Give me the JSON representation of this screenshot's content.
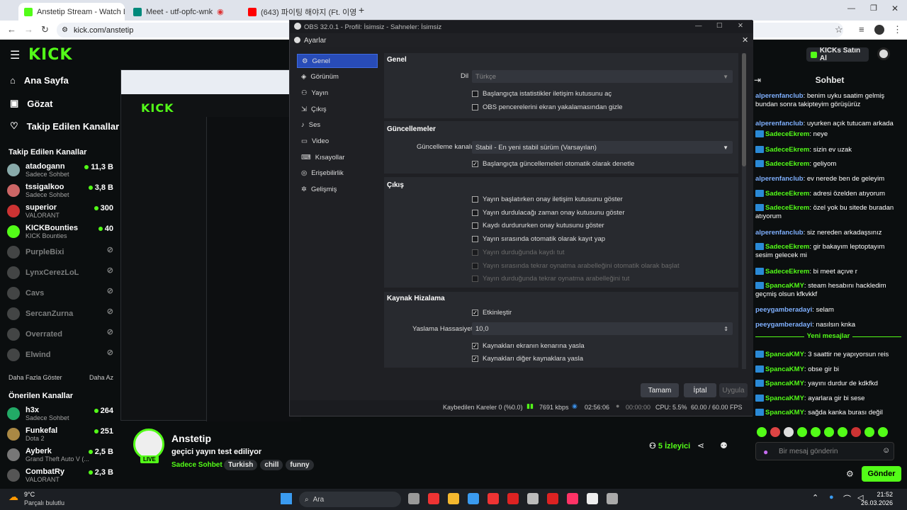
{
  "browser": {
    "tabs": [
      {
        "label": "Anstetip Stream - Watch Live o",
        "active": true,
        "color": "#53fc18"
      },
      {
        "label": "Meet - utf-opfc-wnk",
        "active": false,
        "color": "#00897b"
      },
      {
        "label": "(643) 파이팅 해야지 (Ft. 이영지",
        "active": false,
        "color": "#ff0000"
      }
    ],
    "url": "kick.com/anstetip"
  },
  "kick": {
    "logo": "KICK",
    "nav": [
      "Ana Sayfa",
      "Gözat",
      "Takip Edilen Kanallar"
    ],
    "followed_title": "Takip Edilen Kanallar",
    "followed": [
      {
        "name": "atadogann",
        "sub": "Sadece Sohbet",
        "count": "11,3 B",
        "color": "#8aa"
      },
      {
        "name": "tssigalkoo",
        "sub": "Sadece Sohbet",
        "count": "3,8 B",
        "color": "#c66"
      },
      {
        "name": "superior",
        "sub": "VALORANT",
        "count": "300",
        "color": "#c33"
      },
      {
        "name": "KICKBounties",
        "sub": "KICK Bounties",
        "count": "40",
        "color": "#53fc18"
      },
      {
        "name": "PurpleBixi",
        "sub": "",
        "count": "",
        "color": "#888"
      },
      {
        "name": "LynxCerezLoL",
        "sub": "",
        "count": "",
        "color": "#888"
      },
      {
        "name": "Cavs",
        "sub": "",
        "count": "",
        "color": "#888"
      },
      {
        "name": "SercanZurna",
        "sub": "",
        "count": "",
        "color": "#888"
      },
      {
        "name": "Overrated",
        "sub": "",
        "count": "",
        "color": "#888"
      },
      {
        "name": "Elwind",
        "sub": "",
        "count": "",
        "color": "#888"
      }
    ],
    "more": "Daha Fazla Göster",
    "less": "Daha Az",
    "rec_title": "Önerilen Kanallar",
    "recommended": [
      {
        "name": "h3x",
        "sub": "Sadece Sohbet",
        "count": "264",
        "color": "#2a6"
      },
      {
        "name": "Funkefal",
        "sub": "Dota 2",
        "count": "251",
        "color": "#a84"
      },
      {
        "name": "Ayberk",
        "sub": "Grand Theft Auto V (...",
        "count": "2,5 B",
        "color": "#777"
      },
      {
        "name": "CombatRy",
        "sub": "VALORANT",
        "count": "2,3 B",
        "color": "#555"
      }
    ],
    "streamer": "Anstetip",
    "stream_title": "geçici yayın test ediliyor",
    "category": "Sadece Sohbet",
    "tags": [
      "Turkish",
      "chill",
      "funny"
    ],
    "live": "LIVE",
    "viewers": "5 İzleyici",
    "buy": "KICKs Satın Al"
  },
  "chat": {
    "title": "Sohbet",
    "messages": [
      {
        "user": "alperenfanclub",
        "text": "benim uyku saatim gelmiş bundan sonra takipteyim görüşürüz",
        "color": "#7fb0ff",
        "badge": false
      },
      {
        "user": "alperenfanclub",
        "text": "uyurken açık tutucam arkada",
        "color": "#7fb0ff",
        "badge": false
      },
      {
        "user": "SadeceEkrem",
        "text": "neye",
        "color": "#53fc18",
        "badge": true
      },
      {
        "user": "SadeceEkrem",
        "text": "sizin ev uzak",
        "color": "#53fc18",
        "badge": true
      },
      {
        "user": "SadeceEkrem",
        "text": "geliyom",
        "color": "#53fc18",
        "badge": true
      },
      {
        "user": "alperenfanclub",
        "text": "ev nerede ben de geleyim",
        "color": "#7fb0ff",
        "badge": false
      },
      {
        "user": "SadeceEkrem",
        "text": "adresi özelden atıyorum",
        "color": "#53fc18",
        "badge": true
      },
      {
        "user": "SadeceEkrem",
        "text": "özel yok bu sitede buradan atıyorum",
        "color": "#53fc18",
        "badge": true
      },
      {
        "user": "alperenfanclub",
        "text": "siz nereden arkadaşsınız",
        "color": "#7fb0ff",
        "badge": false
      },
      {
        "user": "SadeceEkrem",
        "text": "gir bakayım leptoptayım sesim gelecek mi",
        "color": "#53fc18",
        "badge": true
      },
      {
        "user": "SadeceEkrem",
        "text": "bi meet açıve r",
        "color": "#53fc18",
        "badge": true
      },
      {
        "user": "SpancaKMY",
        "text": "steam hesabını hackledim geçmiş olsun kfkvkkf",
        "color": "#53fc18",
        "badge": true
      },
      {
        "user": "peeygamberadayi",
        "text": "selam",
        "color": "#7fb0ff",
        "badge": false
      },
      {
        "user": "peeygamberadayi",
        "text": "nasılsın knka",
        "color": "#7fb0ff",
        "badge": false
      }
    ],
    "new_label": "Yeni mesajlar",
    "new_messages": [
      {
        "user": "SpancaKMY",
        "text": "3 saattir ne yapıyorsun reis",
        "color": "#53fc18"
      },
      {
        "user": "SpancaKMY",
        "text": "obse gir bi",
        "color": "#53fc18"
      },
      {
        "user": "SpancaKMY",
        "text": "yayını durdur de kdkfkd",
        "color": "#53fc18"
      },
      {
        "user": "SpancaKMY",
        "text": "ayarlara gir bi sese",
        "color": "#53fc18"
      },
      {
        "user": "SpancaKMY",
        "text": "sağda kanka burası değil",
        "color": "#53fc18"
      }
    ],
    "input_placeholder": "Bir mesaj gönderin",
    "send": "Gönder"
  },
  "obs": {
    "title": "OBS 32.0.1 - Profil: İsimsiz - Sahneler: İsimsiz",
    "dialog": "Ayarlar",
    "sidebar": [
      "Genel",
      "Görünüm",
      "Yayın",
      "Çıkış",
      "Ses",
      "Video",
      "Kısayollar",
      "Erişebilirlik",
      "Gelişmiş"
    ],
    "general": {
      "title": "Genel",
      "lang_label": "Dil",
      "lang_value": "Türkçe",
      "checks": [
        "Başlangıçta istatistikler iletişim kutusunu aç",
        "OBS pencerelerini ekran yakalamasından gizle"
      ]
    },
    "updates": {
      "title": "Güncellemeler",
      "channel_label": "Güncelleme kanalı",
      "channel_value": "Stabil - En yeni stabil sürüm (Varsayılan)",
      "check": "Başlangıçta güncellemeleri otomatik olarak denetle"
    },
    "output": {
      "title": "Çıkış",
      "checks": [
        "Yayın başlatırken onay iletişim kutusunu göster",
        "Yayın durdulacağı zaman onay kutusunu göster",
        "Kaydı durdururken onay kutusunu göster",
        "Yayın sırasında otomatik olarak kayıt yap"
      ],
      "disabled": [
        "Yayın durduğunda kaydı tut",
        "Yayın sırasında tekrar oynatma arabelleğini otomatik olarak başlat",
        "Yayın durduğunda tekrar oynatma arabelleğini tut"
      ]
    },
    "snap": {
      "title": "Kaynak Hizalama",
      "enable": "Etkinleştir",
      "sens_label": "Yaslama Hassasiyeti",
      "sens_value": "10,0",
      "checks": [
        "Kaynakları ekranın kenarına yasla",
        "Kaynakları diğer kaynaklara yasla"
      ]
    },
    "buttons": {
      "ok": "Tamam",
      "cancel": "İptal",
      "apply": "Uygula"
    },
    "status": {
      "dropped": "Kaybedilen Kareler 0 (%0.0)",
      "bitrate": "7691 kbps",
      "live_time": "02:56:06",
      "rec_time": "00:00:00",
      "cpu": "CPU: 5.5%",
      "fps": "60.00 / 60.00 FPS"
    }
  },
  "taskbar": {
    "weather_temp": "9°C",
    "weather_text": "Parçalı bulutlu",
    "search": "Ara",
    "time": "21:52",
    "date": "26.03.2026"
  }
}
